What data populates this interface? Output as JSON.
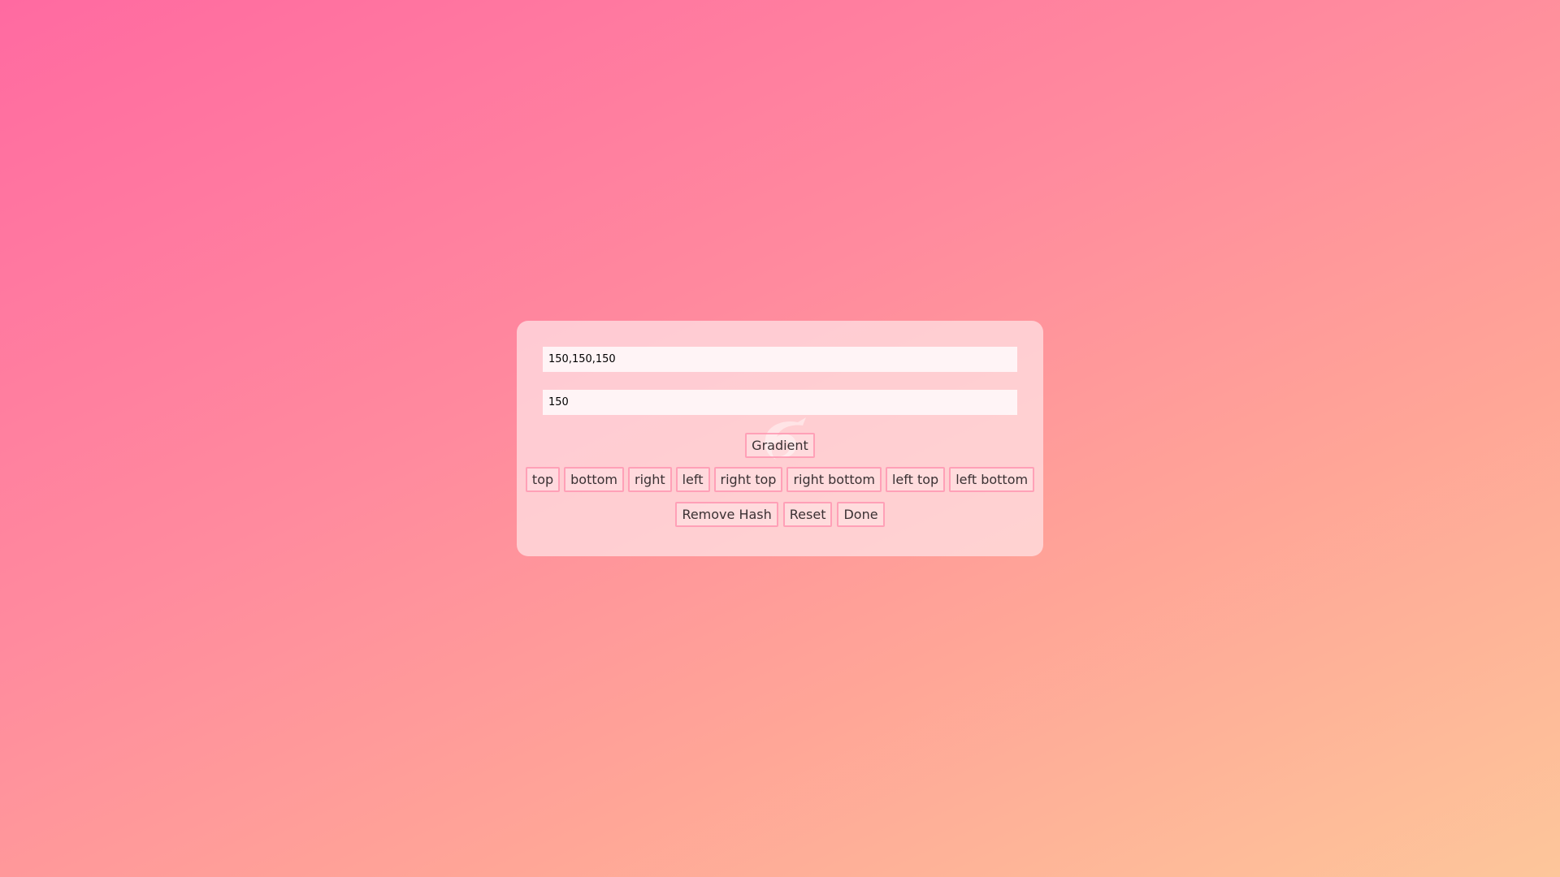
{
  "colors": {
    "background_start": "#ff6aa1",
    "background_end": "#fdc69a",
    "panel": "#ffe4e8",
    "button_border": "#ff8caa"
  },
  "form": {
    "color_value": "150,150,150",
    "alpha_value": "150"
  },
  "buttons": {
    "gradient": "Gradient",
    "directions": [
      "top",
      "bottom",
      "right",
      "left",
      "right top",
      "right bottom",
      "left top",
      "left bottom"
    ],
    "remove_hash": "Remove Hash",
    "reset": "Reset",
    "done": "Done"
  },
  "watermark_icon": "swirl-logo-icon"
}
